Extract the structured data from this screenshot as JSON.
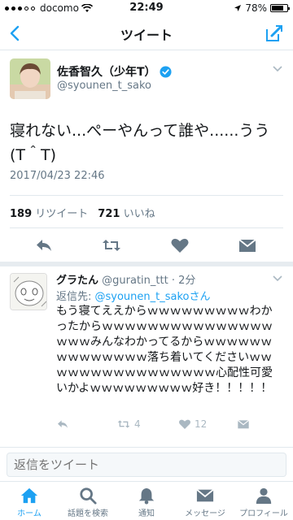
{
  "status_bar": {
    "carrier": "docomo",
    "time": "22:49",
    "battery": "78%",
    "battery_level": 0.78
  },
  "nav": {
    "title": "ツイート"
  },
  "tweet": {
    "display_name": "佐香智久（少年T）",
    "handle": "@syounen_t_sako",
    "text": "寝れない...ぺーやんって誰や......うう(T＾T)",
    "timestamp": "2017/04/23 22:46",
    "retweets": "189",
    "retweets_label": "リツイート",
    "likes": "721",
    "likes_label": "いいね"
  },
  "reply": {
    "display_name": "グラたん",
    "handle_time": "@guratin_ttt · 2分",
    "reply_to_prefix": "返信先: ",
    "reply_to_mention": "@syounen_t_sakoさん",
    "text": "もう寝てええからｗｗｗｗｗｗｗｗｗわかったからｗｗｗｗｗｗｗｗｗｗｗｗｗｗｗｗｗｗみんなわかってるからｗｗｗｗｗｗｗｗｗｗｗｗｗｗ落ち着いてくださいｗｗｗｗｗｗｗｗｗｗｗｗｗｗｗｗ心配性可愛いかよｗｗｗｗｗｗｗｗｗ好き！！！！！",
    "retweet_count": "4",
    "like_count": "12"
  },
  "reply_box": {
    "placeholder": "返信をツイート"
  },
  "tabs": [
    {
      "label": "ホーム",
      "icon": "home-icon",
      "active": true
    },
    {
      "label": "話題を検索",
      "icon": "search-icon",
      "active": false
    },
    {
      "label": "通知",
      "icon": "bell-icon",
      "active": false
    },
    {
      "label": "メッセージ",
      "icon": "mail-icon",
      "active": false
    },
    {
      "label": "プロフィール",
      "icon": "profile-icon",
      "active": false
    }
  ],
  "colors": {
    "accent": "#1da1f2",
    "verified": "#1da1f2",
    "muted": "#657786"
  }
}
